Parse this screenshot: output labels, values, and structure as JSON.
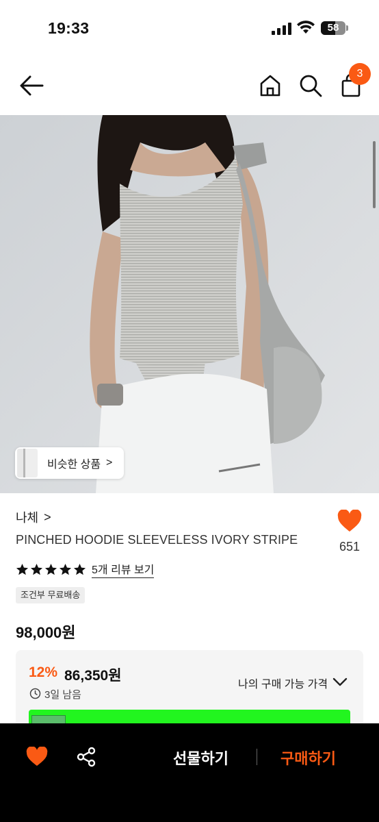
{
  "status_bar": {
    "time": "19:33",
    "battery": "58",
    "battery_level": 0.58
  },
  "nav": {
    "back_icon": "arrow-left-icon",
    "home_icon": "home-icon",
    "search_icon": "search-icon",
    "bag_icon": "shopping-bag-icon",
    "cart_count": "3"
  },
  "hero": {
    "similar_label": "비슷한 상품",
    "similar_chevron": ">"
  },
  "product": {
    "brand": "나체",
    "brand_chevron": ">",
    "title": "PINCHED HOODIE SLEEVELESS IVORY STRIPE",
    "likes": "651",
    "rating_stars": 5,
    "review_link": "5개 리뷰 보기",
    "shipping_tag": "조건부 무료배송",
    "price": "98,000원"
  },
  "price_card": {
    "discount_rate": "12%",
    "discount_price": "86,350원",
    "time_left": "3일 남음",
    "my_price_label": "나의 구매 가능 가격"
  },
  "bottom_bar": {
    "gift_label": "선물하기",
    "buy_label": "구매하기"
  },
  "colors": {
    "accent": "#fa5a14",
    "banner": "#22f51f",
    "bar": "#000000"
  }
}
